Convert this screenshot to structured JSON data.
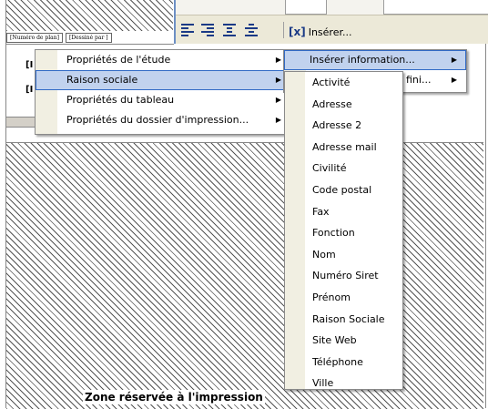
{
  "toolbar": {
    "insert_label": "Insérer...",
    "insert_glyph": "[x]",
    "icons": [
      "align-left-icon",
      "align-right-icon",
      "align-top-icon",
      "align-bottom-icon"
    ]
  },
  "header": {
    "tabs": [
      "[Numéro de plan]",
      "[Dessiné par ]"
    ],
    "field_codes": [
      "[I",
      "[I"
    ]
  },
  "main_menu": {
    "items": [
      {
        "label": "Propriétés de l'étude",
        "has_submenu": true
      },
      {
        "label": "Raison sociale",
        "has_submenu": true,
        "highlighted": true
      },
      {
        "label": "Propriétés du tableau",
        "has_submenu": true
      },
      {
        "label": "Propriétés du dossier d'impression...",
        "has_submenu": true
      }
    ]
  },
  "insert_menu": {
    "items": [
      {
        "label": "Insérer information...",
        "has_submenu": true,
        "highlighted": true
      },
      {
        "label": "fini...",
        "has_submenu": true
      }
    ]
  },
  "submenu": {
    "items": [
      "Activité",
      "Adresse",
      "Adresse 2",
      "Adresse mail",
      "Civilité",
      "Code postal",
      "Fax",
      "Fonction",
      "Nom",
      "Numéro Siret",
      "Prénom",
      "Raison Sociale",
      "Site Web",
      "Téléphone",
      "Ville"
    ]
  },
  "print_zone_label": "Zone réservée à l'impression",
  "colors": {
    "highlight": "#c1d2ee",
    "highlight_border": "#316ac5",
    "menu_gutter": "#f1efe2",
    "toolbar": "#ece9d8"
  }
}
